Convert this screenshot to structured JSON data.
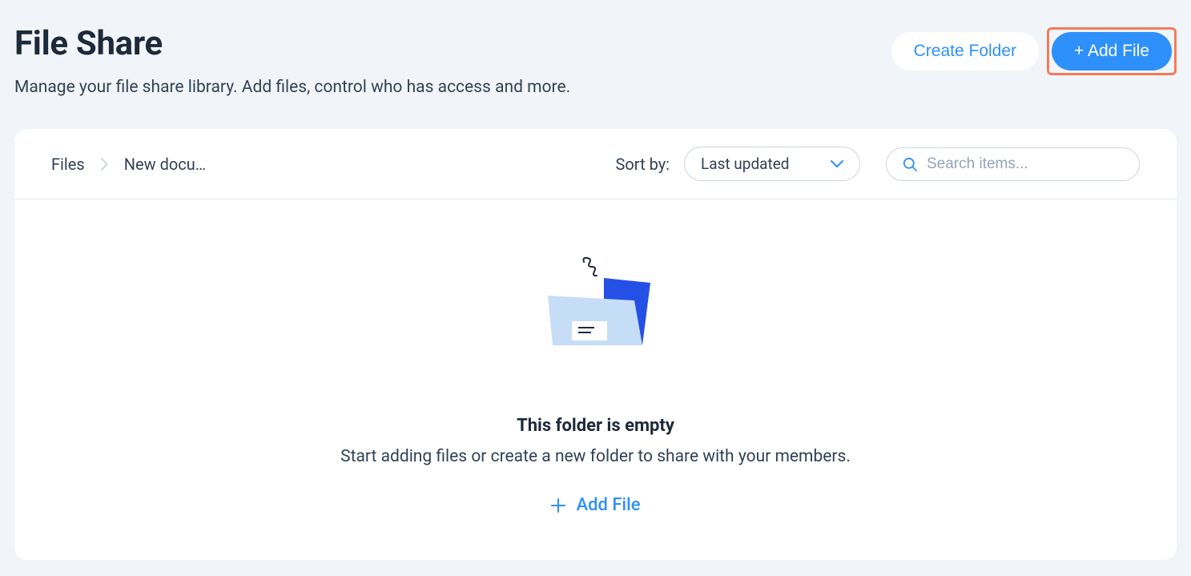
{
  "header": {
    "title": "File Share",
    "subtitle": "Manage your file share library. Add files, control who has access and more.",
    "create_folder_label": "Create Folder",
    "add_file_label": "+ Add File"
  },
  "breadcrumb": {
    "root": "Files",
    "current": "New docu…"
  },
  "toolbar": {
    "sort_label": "Sort by:",
    "sort_value": "Last updated",
    "search_placeholder": "Search items..."
  },
  "empty_state": {
    "title": "This folder is empty",
    "subtitle": "Start adding files or create a new folder to share with your members.",
    "action_label": "Add File"
  }
}
